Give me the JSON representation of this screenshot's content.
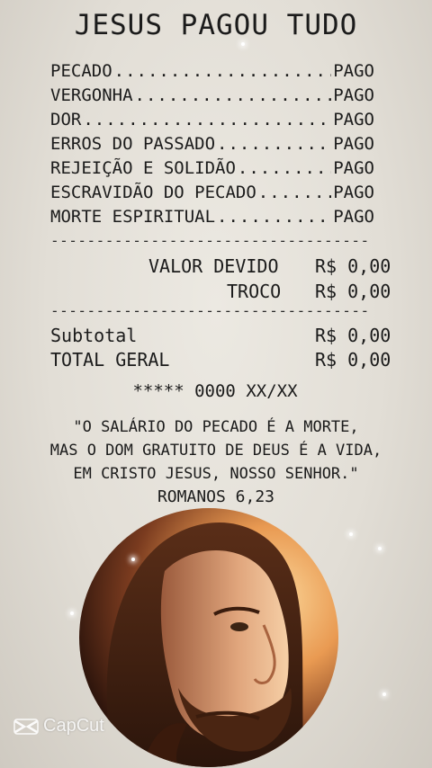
{
  "title": "JESUS PAGOU TUDO",
  "items": [
    {
      "label": "PECADO",
      "status": "PAGO"
    },
    {
      "label": "VERGONHA",
      "status": "PAGO"
    },
    {
      "label": "DOR",
      "status": "PAGO"
    },
    {
      "label": "ERROS DO PASSADO",
      "status": "PAGO"
    },
    {
      "label": "REJEIÇÃO E SOLIDÃO",
      "status": "PAGO"
    },
    {
      "label": "ESCRAVIDÃO DO PECADO",
      "status": "PAGO"
    },
    {
      "label": "MORTE ESPIRITUAL",
      "status": "PAGO"
    }
  ],
  "valor_devido": {
    "label": "VALOR DEVIDO",
    "value": "R$ 0,00"
  },
  "troco": {
    "label": "TROCO",
    "value": "R$ 0,00"
  },
  "subtotal": {
    "label": "Subtotal",
    "value": "R$ 0,00"
  },
  "total": {
    "label": "TOTAL GERAL",
    "value": "R$ 0,00"
  },
  "card_line": "***** 0000 XX/XX",
  "verse": {
    "line1": "\"O SALÁRIO DO PECADO É A MORTE,",
    "line2": "MAS O DOM GRATUITO DE DEUS É A VIDA,",
    "line3": "EM CRISTO JESUS, NOSSO SENHOR.\""
  },
  "reference": "ROMANOS 6,23",
  "watermark": "CapCut",
  "icons": {
    "watermark": "capcut-logo-icon"
  },
  "colors": {
    "paper": "#e2ded6",
    "ink": "#1b1b1b",
    "glow": "#f3b469"
  }
}
